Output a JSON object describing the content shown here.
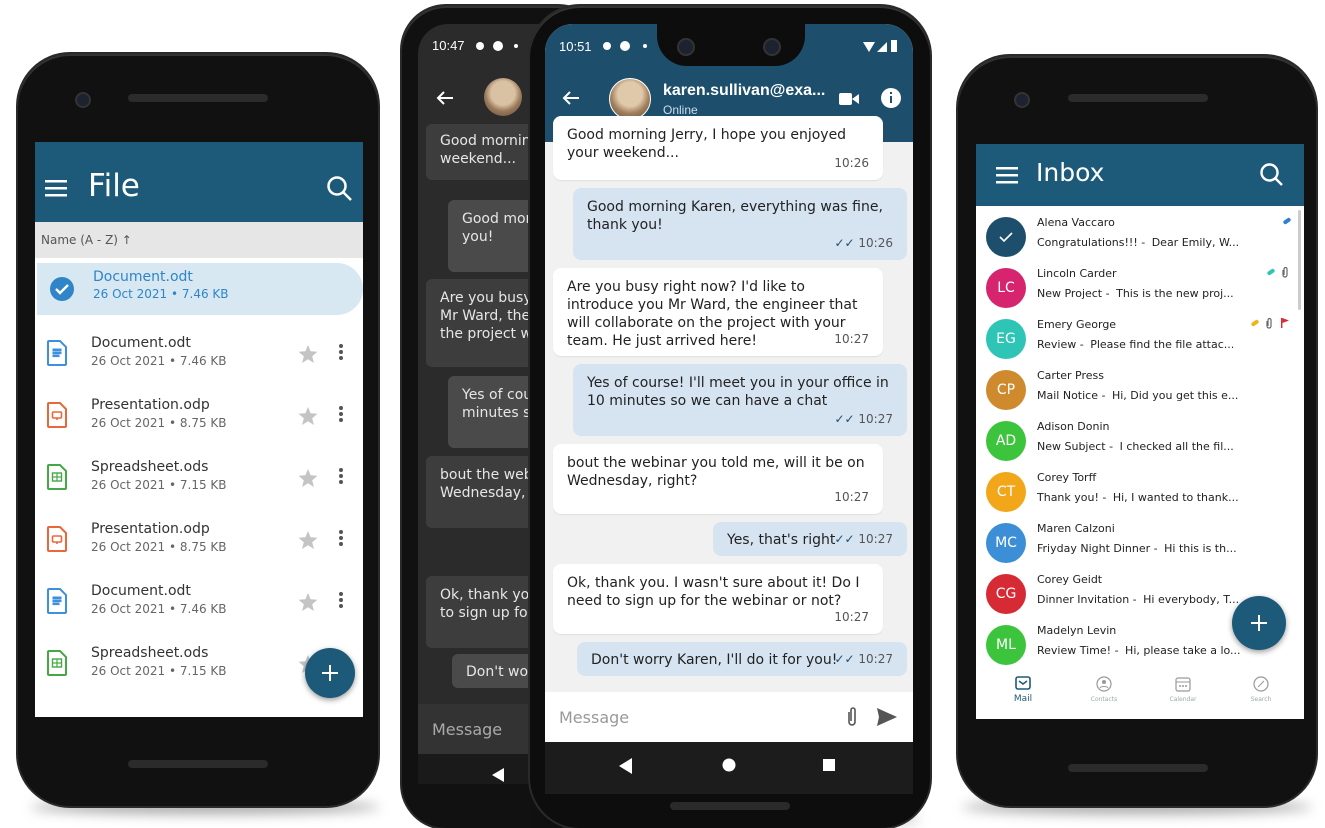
{
  "file_app": {
    "title": "File",
    "sort_label": "Name (A - Z) ↑",
    "files": [
      {
        "name": "Document.odt",
        "meta": "26 Oct 2021 • 7.46 KB",
        "type": "document",
        "selected": true
      },
      {
        "name": "Document.odt",
        "meta": "26 Oct 2021 • 7.46 KB",
        "type": "document"
      },
      {
        "name": "Presentation.odp",
        "meta": "26 Oct 2021 • 8.75 KB",
        "type": "presentation"
      },
      {
        "name": "Spreadsheet.ods",
        "meta": "26 Oct 2021 • 7.15 KB",
        "type": "spreadsheet"
      },
      {
        "name": "Presentation.odp",
        "meta": "26 Oct 2021 • 8.75 KB",
        "type": "presentation"
      },
      {
        "name": "Document.odt",
        "meta": "26 Oct 2021 • 7.46 KB",
        "type": "document"
      },
      {
        "name": "Spreadsheet.ods",
        "meta": "26 Oct 2021 • 7.15 KB",
        "type": "spreadsheet"
      }
    ],
    "fab_icon": "plus-icon"
  },
  "dark_chat": {
    "time": "10:47",
    "messages": [
      "Good morning",
      "weekend...",
      "Good morn",
      "you!",
      "Are you busy r",
      "Mr Ward, the e",
      "the project wit",
      "Yes of cour",
      "minutes so",
      "bout the webin",
      "Wednesday, ri",
      "Ok, thank you.",
      "to sign up for t",
      "Don't worr"
    ],
    "input_placeholder": "Message"
  },
  "chat": {
    "time": "10:51",
    "contact_name": "karen.sullivan@exa...",
    "contact_status": "Online",
    "messages": [
      {
        "dir": "in",
        "text": "Good morning Jerry, I hope you enjoyed your weekend...",
        "time": "10:26"
      },
      {
        "dir": "out",
        "text": "Good morning Karen, everything was fine, thank you!",
        "time": "10:26"
      },
      {
        "dir": "in",
        "text": "Are you busy right now? I'd like to introduce you Mr Ward, the engineer that will collaborate on the project with your team. He just arrived here!",
        "time": "10:27"
      },
      {
        "dir": "out",
        "text": "Yes of course! I'll meet you in your office in 10 minutes so we can have a chat",
        "time": "10:27"
      },
      {
        "dir": "in",
        "text": "bout the webinar you told me, will it be on Wednesday, right?",
        "time": "10:27"
      },
      {
        "dir": "out",
        "text": "Yes, that's right",
        "time": "10:27"
      },
      {
        "dir": "in",
        "text": "Ok, thank you. I wasn't sure about it! Do I need to sign up for the webinar or not?",
        "time": "10:27"
      },
      {
        "dir": "out",
        "text": "Don't worry Karen, I'll do it for you!",
        "time": "10:27"
      }
    ],
    "input_placeholder": "Message"
  },
  "inbox": {
    "title": "Inbox",
    "emails": [
      {
        "initials": "",
        "from": "Alena Vaccaro",
        "subject": "Congratulations!!! - ",
        "preview": "Dear Emily, W...",
        "color": "#1d4f6d",
        "selected": true
      },
      {
        "initials": "LC",
        "from": "Lincoln Carder",
        "subject": "New Project - ",
        "preview": "This is the new proj...",
        "color": "#d6246e"
      },
      {
        "initials": "EG",
        "from": "Emery George",
        "subject": "Review - ",
        "preview": "Please find the file attac...",
        "color": "#2ec4b6"
      },
      {
        "initials": "CP",
        "from": "Carter Press",
        "subject": "Mail Notice - ",
        "preview": "Hi, Did you get this e...",
        "color": "#cf8a2e"
      },
      {
        "initials": "AD",
        "from": "Adison Donin",
        "subject": "New Subject - ",
        "preview": "I checked all the fil...",
        "color": "#3cc43c"
      },
      {
        "initials": "CT",
        "from": "Corey Torff",
        "subject": "Thank you! - ",
        "preview": "Hi, I wanted to thank...",
        "color": "#f2a71b"
      },
      {
        "initials": "MC",
        "from": "Maren Calzoni",
        "subject": "Friyday Night Dinner - ",
        "preview": "Hi this is th...",
        "color": "#3c8fd6"
      },
      {
        "initials": "CG",
        "from": "Corey Geidt",
        "subject": "Dinner Invitation - ",
        "preview": "Hi everybody, T...",
        "color": "#d62b35"
      },
      {
        "initials": "ML",
        "from": "Madelyn Levin",
        "subject": "Review Time! - ",
        "preview": "Hi, please take a lo...",
        "color": "#3cc43c"
      }
    ],
    "nav": [
      {
        "label": "Mail",
        "icon": "mail-icon",
        "active": true
      },
      {
        "label": "Contacts",
        "icon": "contacts-icon"
      },
      {
        "label": "Calendar",
        "icon": "calendar-icon"
      },
      {
        "label": "Search",
        "icon": "search-icon"
      }
    ],
    "accent": "#1d5a7a"
  }
}
